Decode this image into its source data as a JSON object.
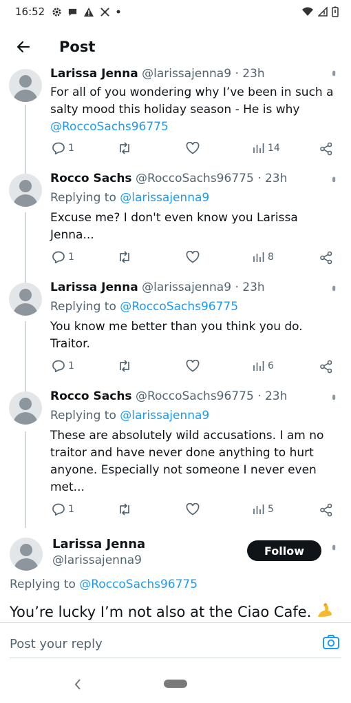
{
  "status_bar": {
    "time": "16:52",
    "icons": [
      "gear-icon",
      "chat-icon",
      "warning-icon",
      "x-logo-icon",
      "dot-icon"
    ],
    "right_icons": [
      "wifi-icon",
      "signal-icon",
      "battery-icon"
    ]
  },
  "header": {
    "title": "Post"
  },
  "replies": [
    {
      "name": "Larissa Jenna",
      "handle": "@larissajenna9",
      "time": "· 23h",
      "replying_to_prefix": "",
      "replying_to": "",
      "text": "For all of you wondering why I’ve been in such a salty mood this holiday season - He is why",
      "mention": "@RoccoSachs96775",
      "stats": {
        "replies": "1",
        "retweets": "",
        "likes": "",
        "views": "14"
      }
    },
    {
      "name": "Rocco Sachs",
      "handle": "@RoccoSachs96775",
      "time": "· 23h",
      "replying_to_prefix": "Replying to",
      "replying_to": "@larissajenna9",
      "text": "Excuse me? I don't even know you Larissa Jenna...",
      "mention": "",
      "stats": {
        "replies": "1",
        "retweets": "",
        "likes": "",
        "views": "8"
      }
    },
    {
      "name": "Larissa Jenna",
      "handle": "@larissajenna9",
      "time": "· 23h",
      "replying_to_prefix": "Replying to",
      "replying_to": "@RoccoSachs96775",
      "text": "You know me better than you think you do. Traitor.",
      "mention": "",
      "stats": {
        "replies": "1",
        "retweets": "",
        "likes": "",
        "views": "6"
      }
    },
    {
      "name": "Rocco Sachs",
      "handle": "@RoccoSachs96775",
      "time": "· 23h",
      "replying_to_prefix": "Replying to",
      "replying_to": "@larissajenna9",
      "text": "These are absolutely wild accusations. I am no traitor and have never done anything to hurt anyone. Especially not someone I never even met...",
      "mention": "",
      "stats": {
        "replies": "1",
        "retweets": "",
        "likes": "",
        "views": "5"
      }
    }
  ],
  "main_post": {
    "name": "Larissa Jenna",
    "handle": "@larissajenna9",
    "follow_label": "Follow",
    "replying_to_prefix": "Replying to",
    "replying_to": "@RoccoSachs96775",
    "text": "You’re lucky I’m not also at the Ciao Cafe."
  },
  "reply_bar": {
    "placeholder": "Post your reply"
  },
  "colors": {
    "link": "#1d9bf0",
    "text": "#0f1419",
    "muted": "#536471",
    "follow_bg": "#0f1419"
  }
}
